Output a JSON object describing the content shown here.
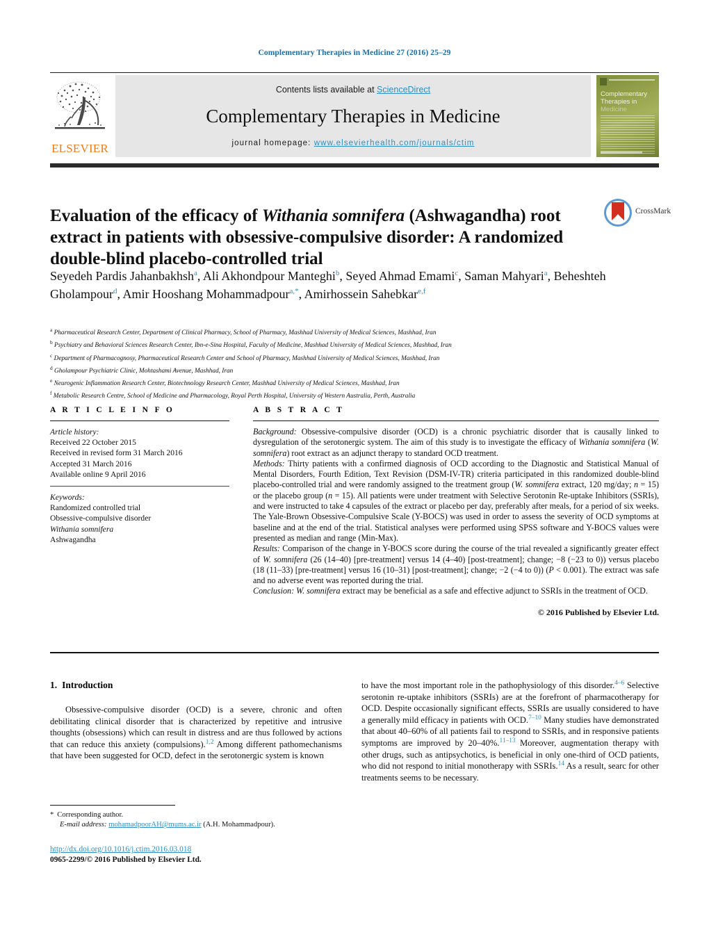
{
  "running_head": "Complementary Therapies in Medicine 27 (2016) 25–29",
  "masthead": {
    "contents_prefix": "Contents lists available at ",
    "contents_link": "ScienceDirect",
    "journal_title": "Complementary Therapies in Medicine",
    "homepage_prefix": "journal homepage: ",
    "homepage_url": "www.elsevierhealth.com/journals/ctim",
    "publisher": "ELSEVIER",
    "cover": {
      "line1": "Complementary",
      "line2": "Therapies in",
      "line3": "Medicine"
    },
    "link_color": "#2e8fc4",
    "band_color": "#e6e6e6",
    "elsevier_orange": "#f07c17"
  },
  "crossmark": {
    "label": "CrossMark"
  },
  "title": {
    "part1": "Evaluation of the efficacy of ",
    "italic1": "Withania somnifera",
    "part2": " (Ashwagandha) root extract in patients with obsessive-compulsive disorder: A randomized double-blind placebo-controlled trial"
  },
  "authors": [
    {
      "name": "Seyedeh Pardis Jahanbakhsh",
      "marks": "a",
      "sep": ", "
    },
    {
      "name": "Ali Akhondpour Manteghi",
      "marks": "b",
      "sep": ", "
    },
    {
      "name": "Seyed Ahmad Emami",
      "marks": "c",
      "sep": ", "
    },
    {
      "name": "Saman Mahyari",
      "marks": "a",
      "sep": ", "
    },
    {
      "name": "Beheshteh Gholampour",
      "marks": "d",
      "sep": ", "
    },
    {
      "name": "Amir Hooshang Mohammadpour",
      "marks": "a,*",
      "sep": ", "
    },
    {
      "name": "Amirhossein Sahebkar",
      "marks": "e,f",
      "sep": ""
    }
  ],
  "affiliations": [
    {
      "mark": "a",
      "text": "Pharmaceutical Research Center, Department of Clinical Pharmacy, School of Pharmacy, Mashhad University of Medical Sciences, Mashhad, Iran"
    },
    {
      "mark": "b",
      "text": "Psychiatry and Behavioral Sciences Research Center, Ibn-e-Sina Hospital, Faculty of Medicine, Mashhad University of Medical Sciences, Mashhad, Iran"
    },
    {
      "mark": "c",
      "text": "Department of Pharmacognosy, Pharmaceutical Research Center and School of Pharmacy, Mashhad University of Medical Sciences, Mashhad, Iran"
    },
    {
      "mark": "d",
      "text": "Gholampour Psychiatric Clinic, Mohtashami Avenue, Mashhad, Iran"
    },
    {
      "mark": "e",
      "text": "Neurogenic Inflammation Research Center, Biotechnology Research Center, Mashhad University of Medical Sciences, Mashhad, Iran"
    },
    {
      "mark": "f",
      "text": "Metabolic Research Centre, School of Medicine and Pharmacology, Royal Perth Hospital, University of Western Australia, Perth, Australia"
    }
  ],
  "article_info": {
    "heading": "A R T I C L E   I N F O",
    "history_label": "Article history:",
    "history": [
      "Received 22 October 2015",
      "Received in revised form 31 March 2016",
      "Accepted 31 March 2016",
      "Available online 9 April 2016"
    ],
    "keywords_label": "Keywords:",
    "keywords": [
      "Randomized controlled trial",
      "Obsessive-compulsive disorder",
      "Withania somnifera",
      "Ashwagandha"
    ],
    "keyword_italic_index": 2
  },
  "abstract": {
    "heading": "A B S T R A C T",
    "background_label": "Background:",
    "background_text": " Obsessive-compulsive disorder (OCD) is a chronic psychiatric disorder that is causally linked to dysregulation of the serotonergic system. The aim of this study is to investigate the efficacy of ",
    "background_italic": "Withania somnifera",
    "background_text2": " (",
    "background_italic2": "W. somnifera",
    "background_text3": ") root extract as an adjunct therapy to standard OCD treatment.",
    "methods_label": "Methods:",
    "methods_text": " Thirty patients with a confirmed diagnosis of OCD according to the Diagnostic and Statistical Manual of Mental Disorders, Fourth Edition, Text Revision (DSM-IV-TR) criteria participated in this randomized double-blind placebo-controlled trial and were randomly assigned to the treatment group (",
    "methods_italic": "W. somnifera",
    "methods_text2": " extract, 120 mg/day; ",
    "methods_italic2": "n",
    "methods_text3": " = 15) or the placebo group (",
    "methods_italic3": "n",
    "methods_text4": " = 15). All patients were under treatment with Selective Serotonin Re-uptake Inhibitors (SSRIs), and were instructed to take 4 capsules of the extract or placebo per day, preferably after meals, for a period of six weeks. The Yale-Brown Obsessive-Compulsive Scale (Y-BOCS) was used in order to assess the severity of OCD symptoms at baseline and at the end of the trial. Statistical analyses were performed using SPSS software and Y-BOCS values were presented as median and range (Min-Max).",
    "results_label": "Results:",
    "results_text": " Comparison of the change in Y-BOCS score during the course of the trial revealed a significantly greater effect of ",
    "results_italic": "W. somnifera",
    "results_text2": " (26 (14–40) [pre-treatment] versus 14 (4–40) [post-treatment]; change; −8 (−23 to 0)) versus placebo (18 (11–33) [pre-treatment] versus 16 (10–31) [post-treatment]; change; −2 (−4 to 0)) (",
    "results_italic2": "P",
    "results_text3": " < 0.001). The extract was safe and no adverse event was reported during the trial.",
    "conclusion_label": "Conclusion:",
    "conclusion_text": " ",
    "conclusion_italic": "W. somnifera",
    "conclusion_text2": " extract may be beneficial as a safe and effective adjunct to SSRIs in the treatment of OCD.",
    "copyright": "© 2016 Published by Elsevier Ltd."
  },
  "introduction": {
    "number": "1.",
    "heading": "Introduction",
    "para_left_1": "Obsessive-compulsive disorder (OCD) is a severe, chronic and often debilitating clinical disorder that is characterized by repetitive and intrusive thoughts (obsessions) which can result in distress and are thus followed by actions that can reduce this anxiety (compulsions).",
    "ref_1": "1,2",
    "para_left_2": " Among different pathomechanisms that have been suggested for OCD, defect in the serotonergic system is known",
    "para_right_1": "to have the most important role in the pathophysiology of this disorder.",
    "ref_2": "4–6",
    "para_right_2": " Selective serotonin re-uptake inhibitors (SSRIs) are at the forefront of pharmacotherapy for OCD. Despite occasionally significant effects, SSRIs are usually considered to have a generally mild efficacy in patients with OCD.",
    "ref_3": "7–10",
    "para_right_3": " Many studies have demonstrated that about 40–60% of all patients fail to respond to SSRIs, and in responsive patients symptoms are improved by 20–40%.",
    "ref_4": "11–13",
    "para_right_4": " Moreover, augmentation therapy with other drugs, such as antipsychotics, is beneficial in only one-third of OCD patients, who did not respond to initial monotherapy with SSRIs.",
    "ref_5": "14",
    "para_right_5": " As a result, searc for other treatments seems to be necessary."
  },
  "footnotes": {
    "corresponding_star": "*",
    "corresponding_text": "Corresponding author.",
    "email_label": "E-mail address:",
    "email_link": "mohamadpoorAH@mums.ac.ir",
    "email_suffix": " (A.H. Mohammadpour).",
    "doi": "http://dx.doi.org/10.1016/j.ctim.2016.03.018",
    "issn_line": "0965-2299/© 2016 Published by Elsevier Ltd."
  }
}
